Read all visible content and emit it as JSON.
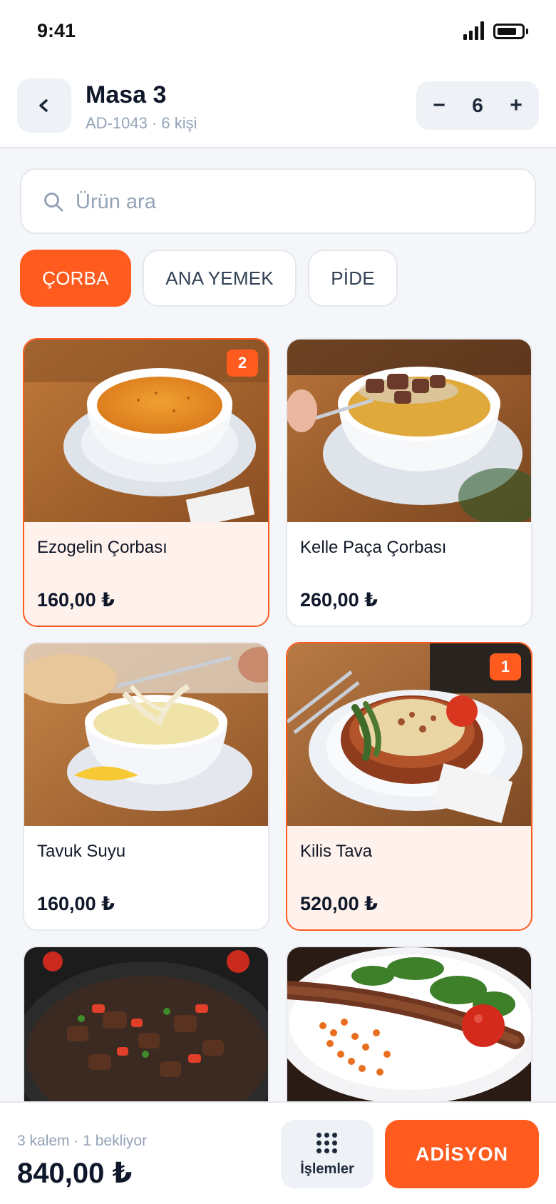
{
  "status_bar": {
    "time": "9:41"
  },
  "header": {
    "title": "Masa 3",
    "subtitle": "AD-1043 · 6 kişi",
    "guest_count": "6",
    "minus_label": "−",
    "plus_label": "+"
  },
  "search": {
    "placeholder": "Ürün ara",
    "value": ""
  },
  "categories": [
    {
      "label": "ÇORBA",
      "active": true
    },
    {
      "label": "ANA YEMEK",
      "active": false
    },
    {
      "label": "PİDE",
      "active": false
    }
  ],
  "products": [
    {
      "name": "Ezogelin Çorbası",
      "price": "160,00 ₺",
      "qty_badge": "2",
      "selected": true,
      "image": "lentil-soup-photo"
    },
    {
      "name": "Kelle Paça Çorbası",
      "price": "260,00 ₺",
      "qty_badge": "",
      "selected": false,
      "image": "meat-soup-photo"
    },
    {
      "name": "Tavuk Suyu",
      "price": "160,00 ₺",
      "qty_badge": "",
      "selected": false,
      "image": "noodle-soup-photo"
    },
    {
      "name": "Kilis Tava",
      "price": "520,00 ₺",
      "qty_badge": "1",
      "selected": true,
      "image": "clay-pot-dish-photo"
    },
    {
      "name": "",
      "price": "",
      "qty_badge": "",
      "selected": false,
      "image": "sauteed-meat-photo"
    },
    {
      "name": "",
      "price": "",
      "qty_badge": "",
      "selected": false,
      "image": "kebab-plate-photo"
    }
  ],
  "bottom_bar": {
    "summary": "3 kalem · 1 bekliyor",
    "total": "840,00 ₺",
    "actions_label": "İşlemler",
    "checkout_label": "ADİSYON"
  },
  "colors": {
    "accent": "#ff5b1f",
    "selected_card_bg": "#fff1ec",
    "text_primary": "#0f172a",
    "text_muted": "#94a3b8"
  },
  "icons": [
    "back-chevron-icon",
    "search-icon",
    "grid-dots-icon",
    "signal-icon",
    "battery-icon"
  ]
}
